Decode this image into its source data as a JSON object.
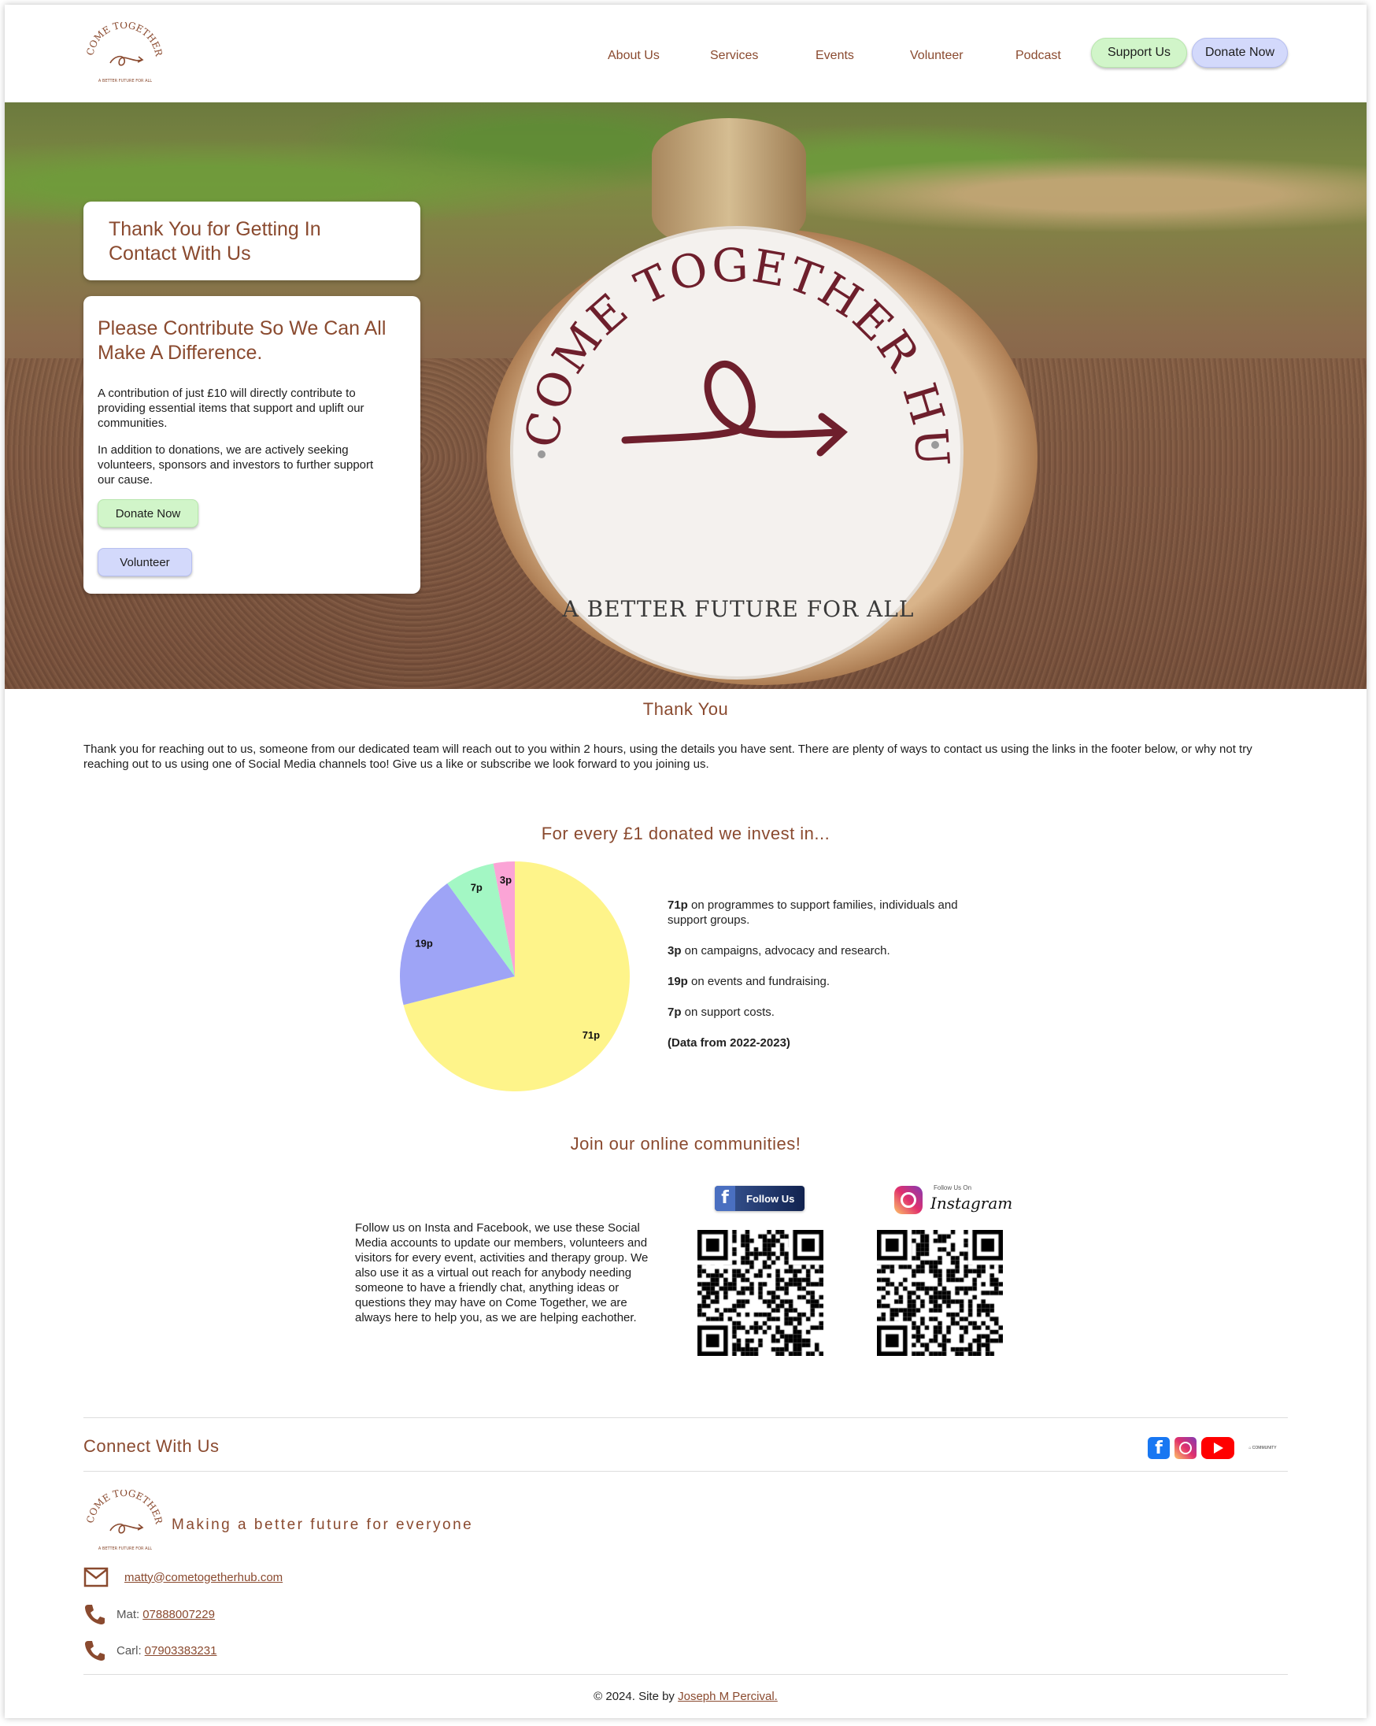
{
  "header": {
    "logo_text_arc": "COME TOGETHER",
    "logo_tagline": "A BETTER FUTURE FOR ALL",
    "nav": [
      "About Us",
      "Services",
      "Events",
      "Volunteer",
      "Podcast"
    ],
    "support_label": "Support Us",
    "donate_label": "Donate Now"
  },
  "hero": {
    "sign_arc": "COME TOGETHER HUB",
    "sign_tagline": "A BETTER FUTURE FOR ALL",
    "thanks_title": "Thank You for Getting In Contact With Us",
    "contribute_title": "Please Contribute So We Can All Make A Difference.",
    "para1": "A contribution of just £10 will directly contribute to providing essential items that support and uplift our communities.",
    "para2": "In addition to donations, we are actively seeking volunteers, sponsors and investors to further support our cause.",
    "donate_label": "Donate Now",
    "volunteer_label": "Volunteer"
  },
  "thanks": {
    "title": "Thank You",
    "text": "Thank you for reaching out to us, someone from our dedicated team will reach out to you within 2 hours, using the details you have sent. There are plenty of ways to contact us using the links in the footer below, or why not try reaching out to us using one of Social Media channels too! Give us a like or subscribe we look forward to you joining us."
  },
  "invest": {
    "title": "For every £1 donated we invest in...",
    "legend": [
      {
        "amount": "71p",
        "text": " on programmes to support families, individuals and support groups."
      },
      {
        "amount": "3p",
        "text": " on campaigns, advocacy and research."
      },
      {
        "amount": "19p",
        "text": " on events and fundraising."
      },
      {
        "amount": "7p",
        "text": " on support costs."
      }
    ],
    "note": "(Data from 2022-2023)"
  },
  "chart_data": {
    "type": "pie",
    "categories": [
      "71p",
      "19p",
      "7p",
      "3p"
    ],
    "values": [
      71,
      19,
      7,
      3
    ],
    "colors": [
      "#fef48a",
      "#9ea4f6",
      "#a3f7c4",
      "#fba4d6"
    ],
    "title": ""
  },
  "community": {
    "title": "Join our online communities!",
    "text": "Follow us on Insta and Facebook, we use these Social Media accounts to update our members, volunteers and visitors for every event, activities and therapy group. We also use it as a virtual out reach for anybody needing someone to have a friendly chat, anything ideas or questions they may have on Come Together, we are always here to help you, as we are helping eachother.",
    "facebook_badge": "Follow Us",
    "instagram_small": "Follow Us On",
    "instagram_badge": "Instagram"
  },
  "footer": {
    "connect_title": "Connect With Us",
    "tagline": "Making a better future for everyone",
    "email": "matty@cometogetherhub.com",
    "phone1_label": "Mat:",
    "phone1": "07888007229",
    "phone2_label": "Carl:",
    "phone2": "07903383231",
    "copyright": "© 2024. Site by ",
    "author": "Joseph M Percival.",
    "icons": [
      "facebook-icon",
      "instagram-icon",
      "youtube-icon",
      "community-logo"
    ],
    "colors": {
      "brand": "#8a4a2f",
      "facebook": "#1877f2",
      "youtube": "#ff0000"
    }
  }
}
